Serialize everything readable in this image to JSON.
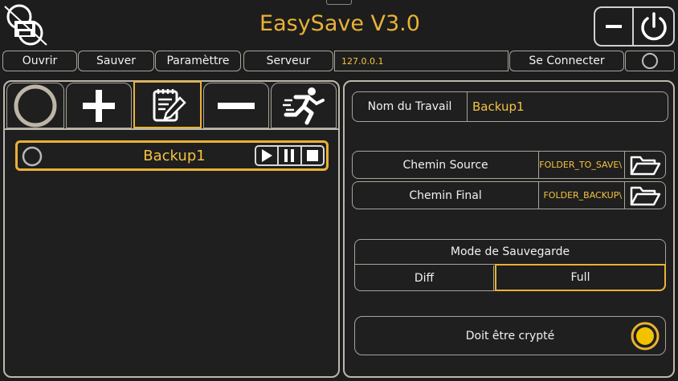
{
  "app": {
    "title": "EasySave V3.0"
  },
  "menu": {
    "open": "Ouvrir",
    "save": "Sauver",
    "settings": "Paramèttre",
    "server": "Serveur",
    "server_address": "127.0.0.1",
    "connect": "Se Connecter"
  },
  "jobs": [
    {
      "name": "Backup1"
    }
  ],
  "detail": {
    "job_name_label": "Nom du Travail",
    "job_name_value": "Backup1",
    "source_label": "Chemin Source",
    "source_value": "\\FOLDER_TO_SAVE",
    "target_label": "Chemin Final",
    "target_value": "\\FOLDER_BACKUP",
    "mode_label": "Mode de Sauvegarde",
    "mode_diff": "Diff",
    "mode_full": "Full",
    "mode_selected": "Full",
    "encrypt_label": "Doit être crypté",
    "encrypt_checked": true
  },
  "colors": {
    "accent": "#e9b236",
    "border": "#bdb8ad",
    "background": "#1d1d1d"
  }
}
